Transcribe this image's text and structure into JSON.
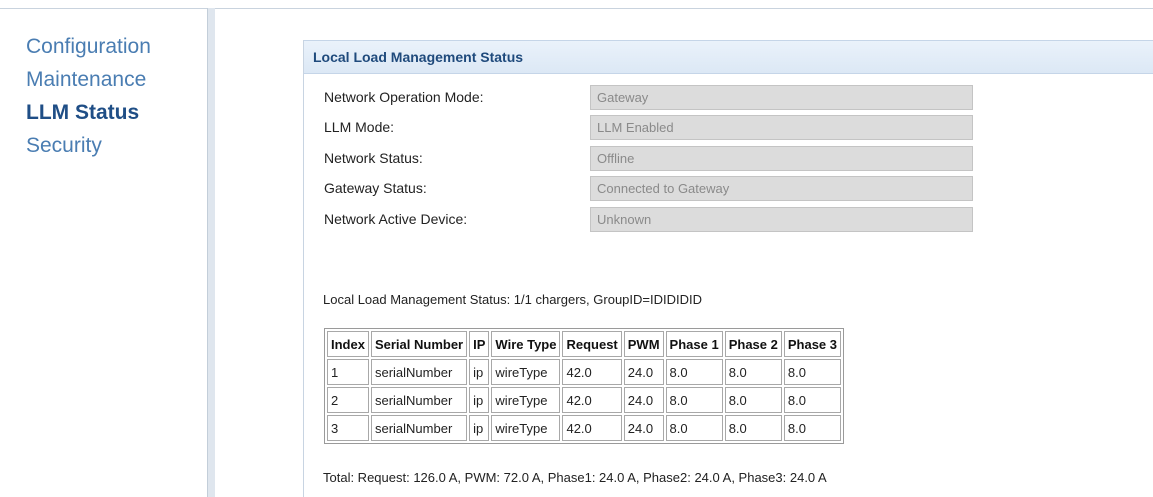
{
  "sidebar": {
    "items": [
      {
        "label": "Configuration"
      },
      {
        "label": "Maintenance"
      },
      {
        "label": "LLM Status"
      },
      {
        "label": "Security"
      }
    ],
    "active": "LLM Status"
  },
  "panel": {
    "title": "Local Load Management Status",
    "fields": [
      {
        "label": "Network Operation Mode:",
        "value": "Gateway"
      },
      {
        "label": "LLM Mode:",
        "value": "LLM Enabled"
      },
      {
        "label": "Network Status:",
        "value": "Offline"
      },
      {
        "label": "Gateway Status:",
        "value": "Connected to Gateway"
      },
      {
        "label": "Network Active Device:",
        "value": "Unknown"
      }
    ],
    "summary": "Local Load Management Status: 1/1 chargers, GroupID=IDIDIDID",
    "table": {
      "headers": [
        "Index",
        "Serial Number",
        "IP",
        "Wire Type",
        "Request",
        "PWM",
        "Phase 1",
        "Phase 2",
        "Phase 3"
      ],
      "rows": [
        [
          "1",
          "serialNumber",
          "ip",
          "wireType",
          "42.0",
          "24.0",
          "8.0",
          "8.0",
          "8.0"
        ],
        [
          "2",
          "serialNumber",
          "ip",
          "wireType",
          "42.0",
          "24.0",
          "8.0",
          "8.0",
          "8.0"
        ],
        [
          "3",
          "serialNumber",
          "ip",
          "wireType",
          "42.0",
          "24.0",
          "8.0",
          "8.0",
          "8.0"
        ]
      ]
    },
    "totals": "Total: Request: 126.0 A, PWM: 72.0 A, Phase1: 24.0 A, Phase2: 24.0 A, Phase3: 24.0 A"
  },
  "colors": {
    "nav_link": "#4a7db2",
    "nav_active": "#1f4e86",
    "header_bg": "#dce8f5",
    "field_bg": "#dcdcdc"
  }
}
